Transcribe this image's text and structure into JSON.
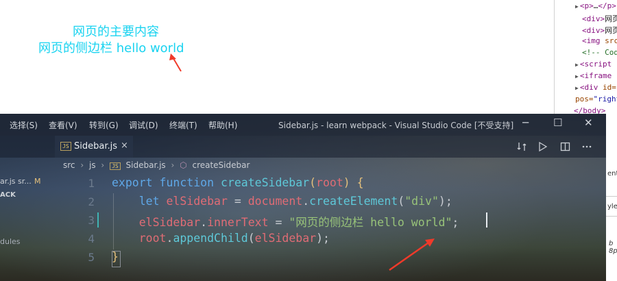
{
  "browser_page": {
    "main_content_text": "网页的主要内容",
    "sidebar_text": "网页的侧边栏 hello world"
  },
  "devtools": {
    "lines": [
      {
        "tri": "▶",
        "tag": "<p>",
        "mid": "…",
        "end": "</p>"
      },
      {
        "tag": "<div>",
        "text": "网页"
      },
      {
        "tag": "<div>",
        "text": "网页"
      },
      {
        "tag": "<img ",
        "attr": "src"
      },
      {
        "comment": "<!-- Cod"
      },
      {
        "tri": "▶",
        "tag": "<script"
      },
      {
        "tri": "▶",
        "tag": "<iframe"
      },
      {
        "tri": "▶",
        "tag": "<div ",
        "attr": "id="
      },
      {
        "attr": "pos=",
        "val": "\"right"
      },
      {
        "tag": "</body>"
      }
    ],
    "side_fragments": [
      "ent",
      "yle",
      "b",
      "8p"
    ]
  },
  "vscode": {
    "menu": [
      "选择(S)",
      "查看(V)",
      "转到(G)",
      "调试(D)",
      "终端(T)",
      "帮助(H)"
    ],
    "window_title": "Sidebar.js - learn webpack - Visual Studio Code [不受支持]",
    "window_controls": {
      "minimize": "─",
      "maximize": "☐",
      "close": "✕"
    },
    "tab": {
      "icon_text": "JS",
      "label": "Sidebar.js",
      "close": "×"
    },
    "toolbar_icons": [
      "compare-icon",
      "run-icon",
      "split-editor-icon",
      "more-icon"
    ],
    "breadcrumb": {
      "segments": [
        "src",
        "js",
        "Sidebar.js",
        "createSidebar"
      ],
      "sep": "›"
    },
    "explorer": {
      "file": "ar.js  sr...",
      "file_status": "M",
      "section": "ACK",
      "item": "dules"
    },
    "line_numbers": [
      "1",
      "2",
      "3",
      "4",
      "5"
    ],
    "code": {
      "l1_kw1": "export",
      "l1_kw2": "function",
      "l1_fn": "createSidebar",
      "l1_p1": "(",
      "l1_arg": "root",
      "l1_p2": ")",
      "l1_brace": "{",
      "l2_kw": "let",
      "l2_var": "elSidebar",
      "l2_eq": "=",
      "l2_obj": "document",
      "l2_dot": ".",
      "l2_fn": "createElement",
      "l2_p1": "(",
      "l2_str": "\"div\"",
      "l2_p2": ");",
      "l3_var": "elSidebar",
      "l3_dot": ".",
      "l3_prop": "innerText",
      "l3_eq": "=",
      "l3_str": "\"网页的侧边栏 hello world\"",
      "l3_end": ";",
      "l4_var": "root",
      "l4_dot": ".",
      "l4_fn": "appendChild",
      "l4_p1": "(",
      "l4_arg": "elSidebar",
      "l4_p2": ");",
      "l5_brace": "}"
    }
  },
  "colors": {
    "page_text": "#1ad3f0",
    "annotation_arrow": "#f03a2a"
  }
}
